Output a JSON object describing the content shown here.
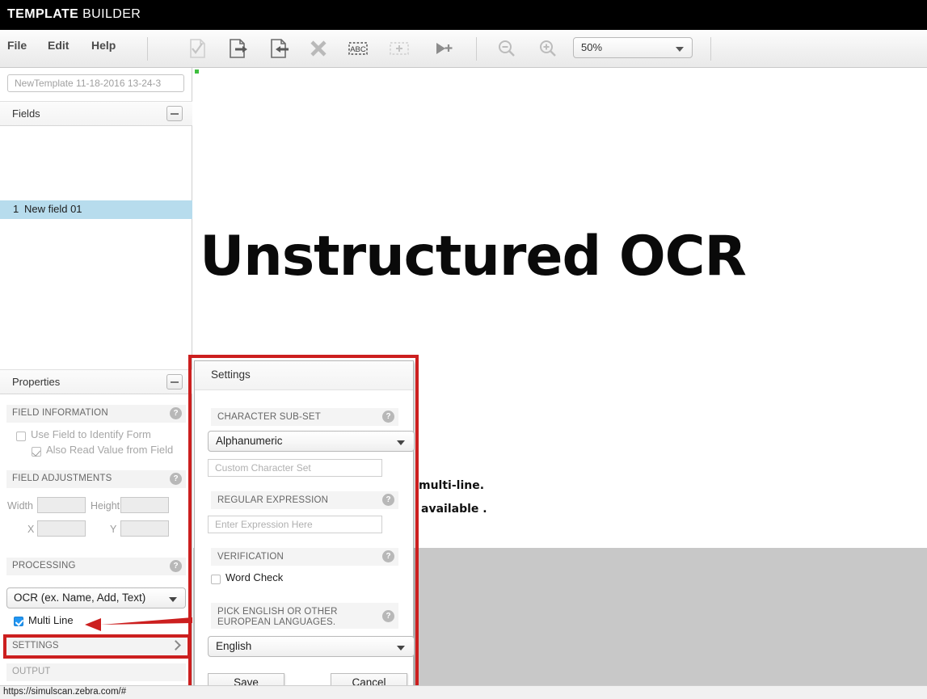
{
  "app": {
    "brand_bold": "TEMPLATE",
    "brand_light": " BUILDER"
  },
  "menubar": {
    "items": [
      {
        "label": "File"
      },
      {
        "label": "Edit"
      },
      {
        "label": "Help"
      }
    ]
  },
  "toolbar": {
    "icons": [
      {
        "name": "validate-document-icon",
        "title": "Validate"
      },
      {
        "name": "export-document-icon",
        "title": "Export"
      },
      {
        "name": "import-document-icon",
        "title": "Import"
      },
      {
        "name": "delete-x-icon",
        "title": "Delete"
      },
      {
        "name": "abc-region-icon",
        "title": "ABC"
      },
      {
        "name": "add-region-icon",
        "title": "Add region"
      },
      {
        "name": "run-add-icon",
        "title": "Run"
      },
      {
        "name": "zoom-out-icon",
        "title": "Zoom out"
      },
      {
        "name": "zoom-in-icon",
        "title": "Zoom in"
      }
    ],
    "zoom_value": "50%"
  },
  "left_panel": {
    "template_name_placeholder": "NewTemplate 11-18-2016 13-24-3",
    "fields_section": {
      "title": "Fields",
      "items": [
        {
          "index": "1",
          "label": "New field 01",
          "selected": true
        }
      ]
    },
    "properties_section": {
      "title": "Properties",
      "field_information": {
        "header": "FIELD INFORMATION",
        "help": "?",
        "checkboxes": [
          {
            "label": "Use Field to Identify Form",
            "checked": false,
            "enabled": false
          },
          {
            "label": "Also Read Value from Field",
            "checked": true,
            "enabled": false
          }
        ]
      },
      "field_adjustments": {
        "header": "FIELD ADJUSTMENTS",
        "help": "?",
        "fields": [
          {
            "label": "Width",
            "value": ""
          },
          {
            "label": "Height",
            "value": ""
          },
          {
            "label": "X",
            "value": ""
          },
          {
            "label": "Y",
            "value": ""
          }
        ]
      },
      "processing": {
        "header": "PROCESSING",
        "help": "?",
        "selected": "OCR (ex. Name, Add, Text)",
        "multi_line": {
          "label": "Multi Line",
          "checked": true
        }
      },
      "settings_row": {
        "label": "SETTINGS",
        "chevron": "chevron-right"
      },
      "output_row": {
        "label": "OUTPUT"
      }
    }
  },
  "canvas": {
    "document_title": "Unstructured OCR",
    "visible_lines": [
      {
        "text": "multi-line."
      },
      {
        "text": "available ."
      }
    ]
  },
  "settings_dialog": {
    "title": "Settings",
    "character_sub_set": {
      "header": "CHARACTER SUB-SET",
      "help": "?",
      "selected": "Alphanumeric",
      "custom_placeholder": "Custom Character Set"
    },
    "regular_expression": {
      "header": "REGULAR EXPRESSION",
      "help": "?",
      "placeholder": "Enter Expression Here"
    },
    "verification": {
      "header": "VERIFICATION",
      "help": "?",
      "word_check": {
        "label": "Word Check",
        "checked": false
      }
    },
    "language": {
      "header": "PICK ENGLISH OR OTHER EUROPEAN LANGUAGES.",
      "help": "?",
      "selected": "English"
    },
    "buttons": {
      "save": "Save",
      "cancel": "Cancel"
    }
  },
  "annotations": {
    "highlight_color": "#cc1f1f",
    "arrow_target": "Multi Line",
    "boxes": [
      "settings-dialog",
      "settings-row"
    ]
  },
  "statusbar": {
    "url": "https://simulscan.zebra.com/#"
  },
  "colors": {
    "titlebar_bg": "#000000",
    "selection_blue": "#b7dced",
    "checkbox_blue": "#2196f3",
    "annotation_red": "#cc1f1f",
    "canvas_grey": "#c8c8c8"
  }
}
